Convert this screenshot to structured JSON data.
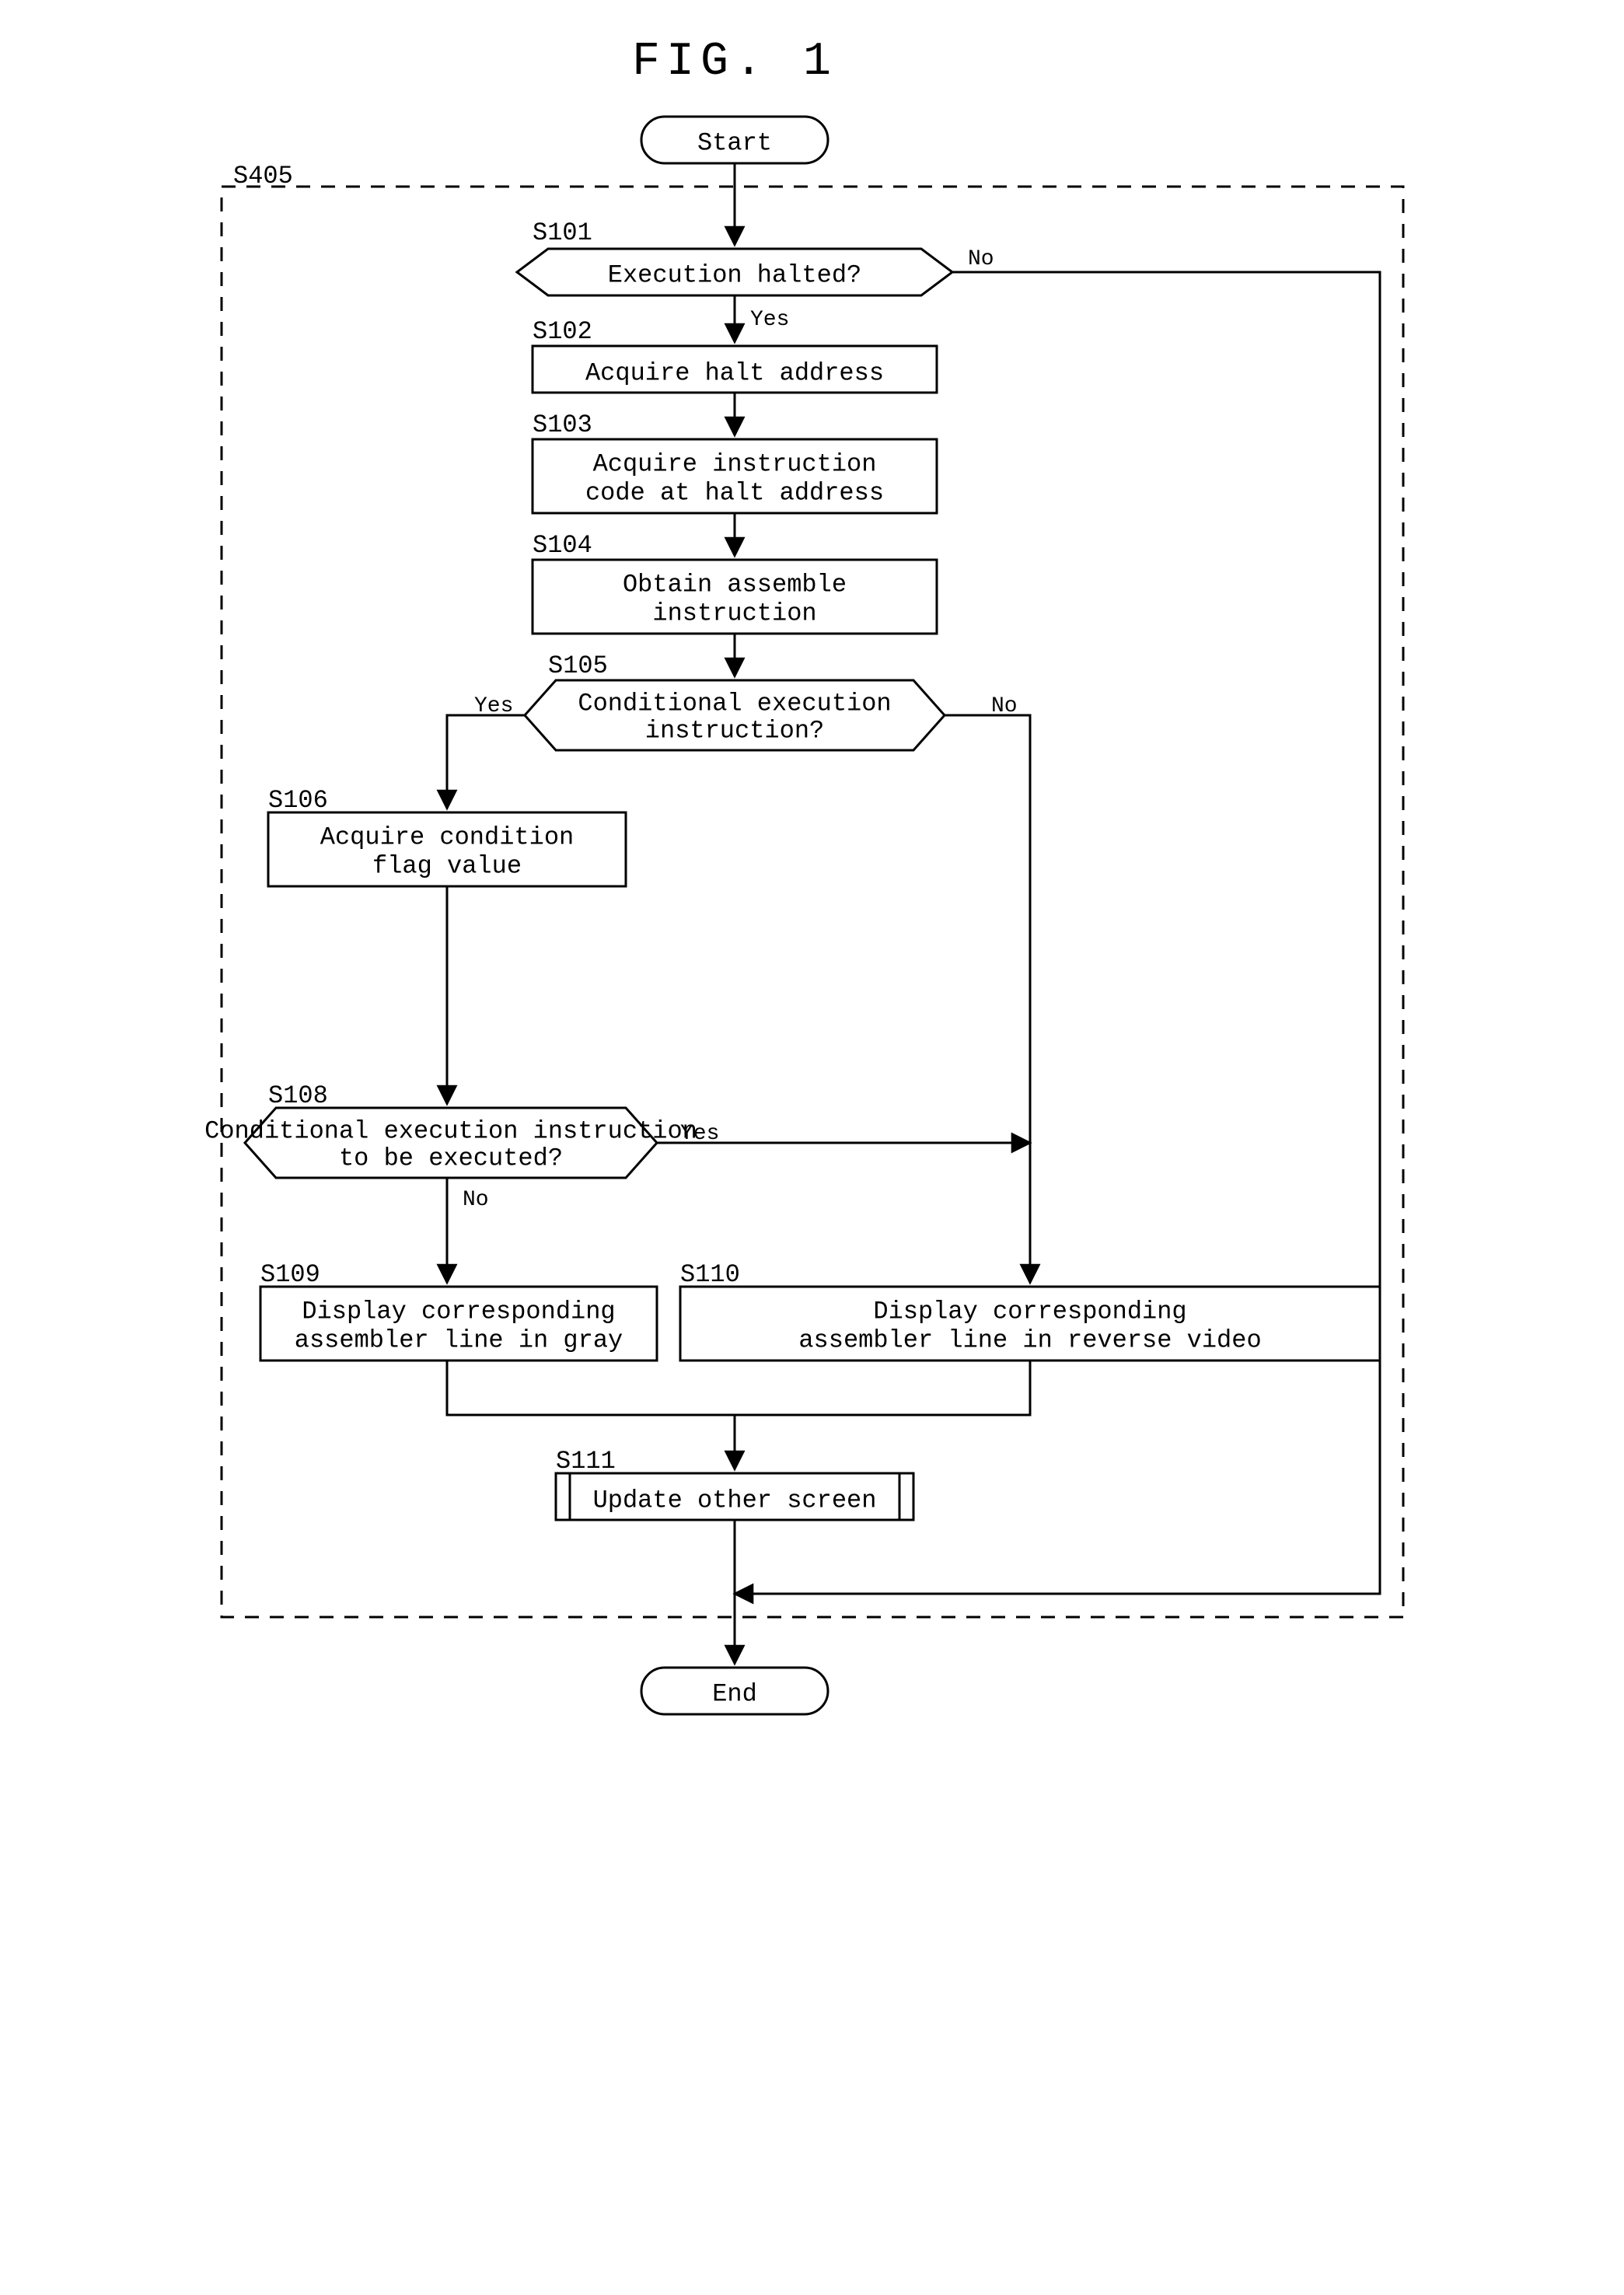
{
  "title": "FIG. 1",
  "container_label": "S405",
  "terminals": {
    "start": "Start",
    "end": "End"
  },
  "steps": {
    "s101": {
      "label": "S101",
      "text": "Execution halted?"
    },
    "s102": {
      "label": "S102",
      "text": "Acquire halt address"
    },
    "s103": {
      "label": "S103",
      "text1": "Acquire instruction",
      "text2": "code at halt address"
    },
    "s104": {
      "label": "S104",
      "text1": "Obtain assemble",
      "text2": "instruction"
    },
    "s105": {
      "label": "S105",
      "text1": "Conditional execution",
      "text2": "instruction?"
    },
    "s106": {
      "label": "S106",
      "text1": "Acquire condition",
      "text2": "flag value"
    },
    "s108": {
      "label": "S108",
      "text1": "Conditional execution instruction",
      "text2": "to be executed?"
    },
    "s109": {
      "label": "S109",
      "text1": "Display corresponding",
      "text2": "assembler line in gray"
    },
    "s110": {
      "label": "S110",
      "text1": "Display corresponding",
      "text2": "assembler line in reverse video"
    },
    "s111": {
      "label": "S111",
      "text": "Update other screen"
    }
  },
  "edges": {
    "yes": "Yes",
    "no": "No"
  }
}
